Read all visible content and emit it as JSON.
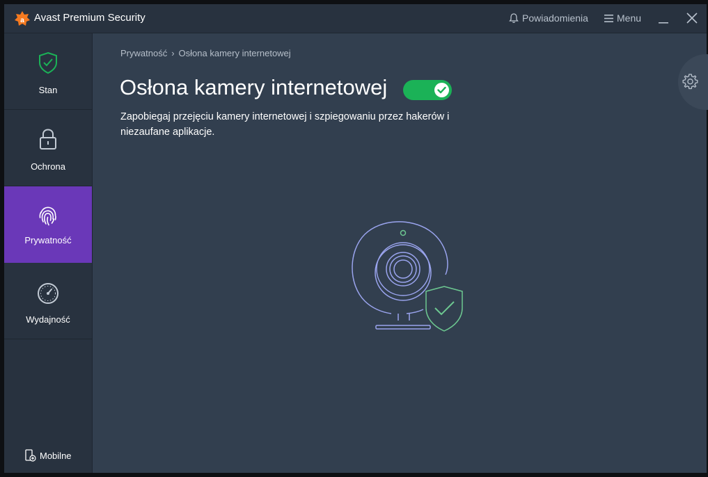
{
  "app": {
    "title": "Avast Premium Security"
  },
  "titlebar": {
    "notifications_label": "Powiadomienia",
    "menu_label": "Menu"
  },
  "sidebar": {
    "items": [
      {
        "label": "Stan",
        "icon": "shield-check-icon",
        "active": false
      },
      {
        "label": "Ochrona",
        "icon": "lock-icon",
        "active": false
      },
      {
        "label": "Prywatność",
        "icon": "fingerprint-icon",
        "active": true
      },
      {
        "label": "Wydajność",
        "icon": "speedometer-icon",
        "active": false
      }
    ],
    "mobile_label": "Mobilne"
  },
  "breadcrumb": {
    "parent": "Prywatność",
    "separator": "›",
    "current": "Osłona kamery internetowej"
  },
  "main": {
    "title": "Osłona kamery internetowej",
    "toggle_on": true,
    "description": "Zapobiegaj przejęciu kamery internetowej i szpiegowaniu przez hakerów i niezaufane aplikacje."
  },
  "colors": {
    "accent_purple": "#6a38b8",
    "toggle_green": "#1bb257",
    "brand_orange": "#f57a20",
    "background": "#323f4f"
  }
}
